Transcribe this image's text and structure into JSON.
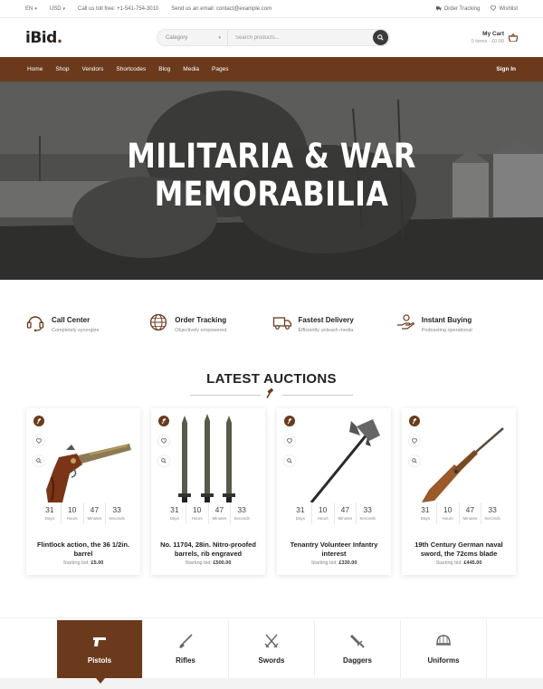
{
  "topbar": {
    "language": "EN",
    "currency": "USD",
    "phone": "Call us toll free: +1-541-754-3010",
    "email": "Send us an email: contact@example.com",
    "order_tracking": "Order Tracking",
    "wishlist": "Wishlist"
  },
  "header": {
    "logo_text": "iBid",
    "logo_dot": ".",
    "search_category": "Category",
    "search_placeholder": "Search products...",
    "cart_title": "My Cart",
    "cart_summary": "0 items - £0.00"
  },
  "nav": {
    "items": [
      "Home",
      "Shop",
      "Vendors",
      "Shortcodes",
      "Blog",
      "Media",
      "Pages"
    ],
    "signin": "Sign In"
  },
  "hero": {
    "line1": "MILITARIA & WAR",
    "line2": "MEMORABILIA"
  },
  "features": [
    {
      "title": "Call Center",
      "subtitle": "Completely synergize",
      "icon": "headset-icon"
    },
    {
      "title": "Order Tracking",
      "subtitle": "Objectively empowered",
      "icon": "globe-icon"
    },
    {
      "title": "Fastest Delivery",
      "subtitle": "Efficiently unleash media",
      "icon": "truck-icon"
    },
    {
      "title": "Instant Buying",
      "subtitle": "Podcasting operational",
      "icon": "hand-icon"
    }
  ],
  "auctions": {
    "title": "LATEST AUCTIONS",
    "countdown_units": [
      "Days",
      "Hours",
      "Minutes",
      "Seconds"
    ],
    "bid_label": "Starting bid:",
    "items": [
      {
        "name": "Flintlock action, the 36 1/2in. barrel",
        "bid": "£5.00",
        "countdown": [
          "31",
          "10",
          "47",
          "33"
        ]
      },
      {
        "name": "No. 11704, 28in. Nitro-proofed barrels, rib engraved",
        "bid": "£500.00",
        "countdown": [
          "31",
          "10",
          "47",
          "33"
        ]
      },
      {
        "name": "Tenantry Volunteer Infantry interest",
        "bid": "£330.00",
        "countdown": [
          "31",
          "10",
          "47",
          "33"
        ]
      },
      {
        "name": "19th Century German naval sword, the 72cms blade",
        "bid": "£445.00",
        "countdown": [
          "31",
          "10",
          "47",
          "33"
        ]
      }
    ]
  },
  "categories": [
    {
      "label": "Pistols",
      "icon": "pistol-icon",
      "active": true
    },
    {
      "label": "Rifles",
      "icon": "rifle-icon",
      "active": false
    },
    {
      "label": "Swords",
      "icon": "swords-icon",
      "active": false
    },
    {
      "label": "Daggers",
      "icon": "dagger-icon",
      "active": false
    },
    {
      "label": "Uniforms",
      "icon": "helmet-icon",
      "active": false
    }
  ],
  "colors": {
    "brand": "#6b3a1d"
  }
}
